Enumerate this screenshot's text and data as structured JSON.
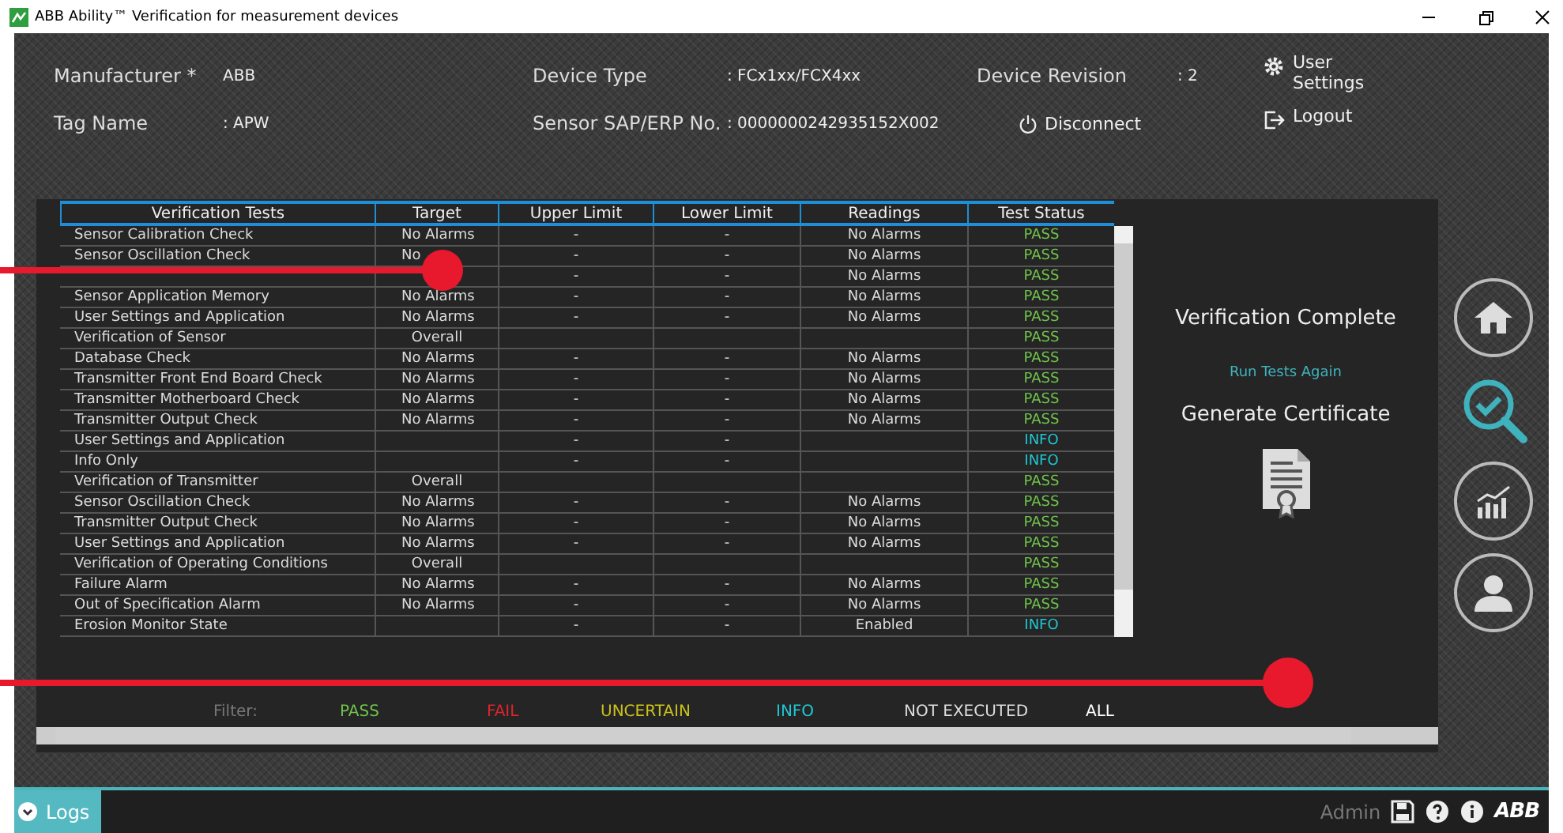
{
  "window": {
    "title": "ABB Ability™ Verification for measurement devices"
  },
  "header": {
    "rows": [
      [
        {
          "label": "Manufacturer *",
          "value": "ABB"
        },
        {
          "label": "Device Type",
          "value": ": FCx1xx/FCX4xx"
        },
        {
          "label": "Device Revision",
          "value": ": 2"
        }
      ],
      [
        {
          "label": "Tag Name",
          "value": ": APW"
        },
        {
          "label": "Sensor SAP/ERP No.",
          "value": ": 0000000242935152X002"
        }
      ]
    ],
    "disconnect": "Disconnect",
    "user_settings": "User Settings",
    "logout": "Logout"
  },
  "table": {
    "columns": [
      "Verification Tests",
      "Target",
      "Upper Limit",
      "Lower Limit",
      "Readings",
      "Test Status"
    ],
    "rows": [
      {
        "cells": [
          "Sensor Calibration Check",
          "No Alarms",
          "-",
          "-",
          "No Alarms"
        ],
        "status": "PASS",
        "color": "#6fc24b"
      },
      {
        "cells": [
          "Sensor Oscillation Check",
          "No",
          "-",
          "-",
          "No Alarms"
        ],
        "status": "PASS",
        "color": "#6fc24b"
      },
      {
        "cells": [
          "",
          "",
          "-",
          "-",
          "No Alarms"
        ],
        "status": "PASS",
        "color": "#6fc24b"
      },
      {
        "cells": [
          "Sensor Application Memory",
          "No Alarms",
          "-",
          "-",
          "No Alarms"
        ],
        "status": "PASS",
        "color": "#6fc24b"
      },
      {
        "cells": [
          "User Settings and Application",
          "No Alarms",
          "-",
          "-",
          "No Alarms"
        ],
        "status": "PASS",
        "color": "#6fc24b"
      },
      {
        "cells": [
          "Verification of Sensor",
          "Overall",
          "",
          "",
          ""
        ],
        "status": "PASS",
        "color": "#6fc24b"
      },
      {
        "cells": [
          "Database Check",
          "No Alarms",
          "-",
          "-",
          "No Alarms"
        ],
        "status": "PASS",
        "color": "#6fc24b"
      },
      {
        "cells": [
          "Transmitter Front End Board Check",
          "No Alarms",
          "-",
          "-",
          "No Alarms"
        ],
        "status": "PASS",
        "color": "#6fc24b"
      },
      {
        "cells": [
          "Transmitter Motherboard Check",
          "No Alarms",
          "-",
          "-",
          "No Alarms"
        ],
        "status": "PASS",
        "color": "#6fc24b"
      },
      {
        "cells": [
          "Transmitter Output Check",
          "No Alarms",
          "-",
          "-",
          "No Alarms"
        ],
        "status": "PASS",
        "color": "#6fc24b"
      },
      {
        "cells": [
          "User Settings and Application",
          "",
          "-",
          "-",
          ""
        ],
        "status": "INFO",
        "color": "#1fc8d4"
      },
      {
        "cells": [
          "Info Only",
          "",
          "-",
          "-",
          ""
        ],
        "status": "INFO",
        "color": "#1fc8d4"
      },
      {
        "cells": [
          "Verification of Transmitter",
          "Overall",
          "",
          "",
          ""
        ],
        "status": "PASS",
        "color": "#6fc24b"
      },
      {
        "cells": [
          "Sensor Oscillation Check",
          "No Alarms",
          "-",
          "-",
          "No Alarms"
        ],
        "status": "PASS",
        "color": "#6fc24b"
      },
      {
        "cells": [
          "Transmitter Output Check",
          "No Alarms",
          "-",
          "-",
          "No Alarms"
        ],
        "status": "PASS",
        "color": "#6fc24b"
      },
      {
        "cells": [
          "User Settings and Application",
          "No Alarms",
          "-",
          "-",
          "No Alarms"
        ],
        "status": "PASS",
        "color": "#6fc24b"
      },
      {
        "cells": [
          "Verification of Operating Conditions",
          "Overall",
          "",
          "",
          ""
        ],
        "status": "PASS",
        "color": "#6fc24b"
      },
      {
        "cells": [
          "Failure Alarm",
          "No Alarms",
          "-",
          "-",
          "No Alarms"
        ],
        "status": "PASS",
        "color": "#6fc24b"
      },
      {
        "cells": [
          "Out of Specification Alarm",
          "No Alarms",
          "-",
          "-",
          "No Alarms"
        ],
        "status": "PASS",
        "color": "#6fc24b"
      },
      {
        "cells": [
          "Erosion Monitor State",
          "",
          "-",
          "-",
          "Enabled"
        ],
        "status": "INFO",
        "color": "#1fc8d4"
      }
    ]
  },
  "side": {
    "status": "Verification Complete",
    "run_again": "Run Tests Again",
    "certificate": "Generate Certificate"
  },
  "filter": {
    "label": "Filter:",
    "options": [
      {
        "label": "PASS",
        "kind": "pass"
      },
      {
        "label": "FAIL",
        "kind": "fail"
      },
      {
        "label": "UNCERTAIN",
        "kind": "uncertain"
      },
      {
        "label": "INFO",
        "kind": "info"
      },
      {
        "label": "NOT EXECUTED",
        "kind": "not_executed"
      },
      {
        "label": "ALL",
        "kind": "all"
      }
    ]
  },
  "nav": [
    {
      "kind": "home",
      "selected": false
    },
    {
      "kind": "verify",
      "selected": true
    },
    {
      "kind": "chart",
      "selected": false
    },
    {
      "kind": "user",
      "selected": false
    }
  ],
  "status_bar": {
    "logs": "Logs",
    "user": "Admin",
    "logo": "ABB"
  }
}
